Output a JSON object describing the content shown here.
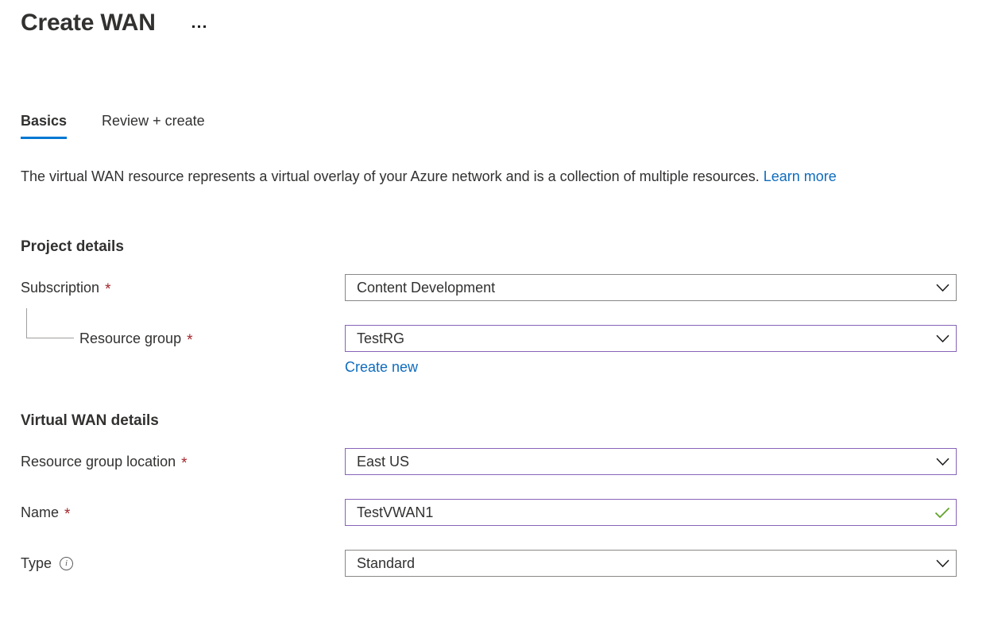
{
  "header": {
    "title": "Create WAN",
    "overflow_menu_label": "More options"
  },
  "tabs": [
    {
      "label": "Basics",
      "active": true
    },
    {
      "label": "Review + create",
      "active": false
    }
  ],
  "description": {
    "text": "The virtual WAN resource represents a virtual overlay of your Azure network and is a collection of multiple resources.",
    "link_label": "Learn more"
  },
  "sections": {
    "project_details": {
      "heading": "Project details"
    },
    "vwan_details": {
      "heading": "Virtual WAN details"
    }
  },
  "fields": {
    "subscription": {
      "label": "Subscription",
      "required_marker": "*",
      "value": "Content Development",
      "icon": "chevron-down-icon"
    },
    "resource_group": {
      "label": "Resource group",
      "required_marker": "*",
      "value": "TestRG",
      "icon": "chevron-down-icon",
      "create_new_label": "Create new"
    },
    "resource_group_location": {
      "label": "Resource group location",
      "required_marker": "*",
      "value": "East US",
      "icon": "chevron-down-icon"
    },
    "name": {
      "label": "Name",
      "required_marker": "*",
      "value": "TestVWAN1",
      "icon": "checkmark-icon"
    },
    "type": {
      "label": "Type",
      "info_icon": "info-icon",
      "value": "Standard",
      "icon": "chevron-down-icon"
    }
  },
  "colors": {
    "accent": "#0078d4",
    "link": "#0f6cbd",
    "required": "#a4262c",
    "visited_border": "#8764b8",
    "default_border": "#8a8886",
    "valid_check": "#5ea226",
    "text": "#323130"
  }
}
